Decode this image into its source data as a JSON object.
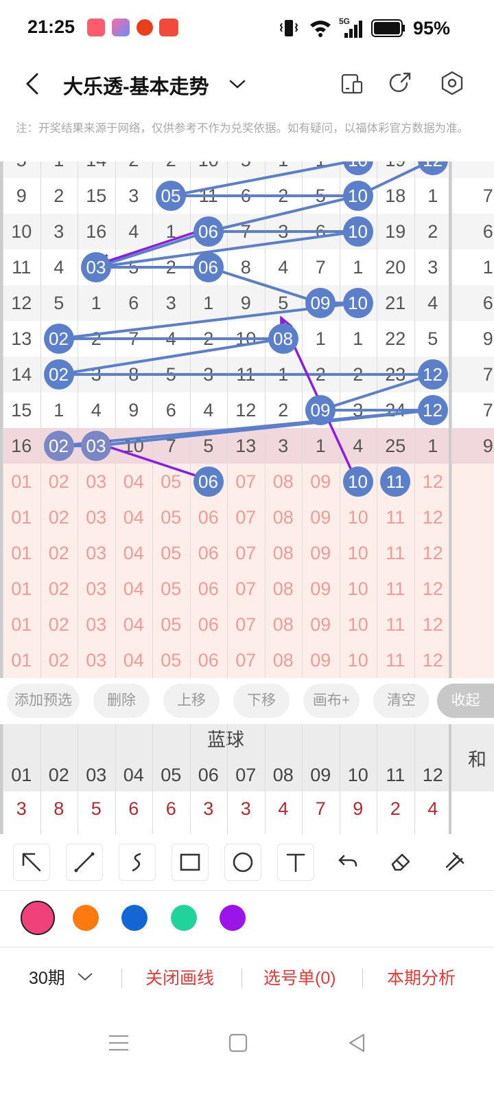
{
  "status": {
    "time": "21:25",
    "battery": "95%",
    "network": "5G"
  },
  "header": {
    "title": "大乐透-基本走势"
  },
  "note": "注：开奖结果来源于网络，仅供参考不作为兑奖依据。如有疑问，以福体彩官方数据为准。",
  "grid": {
    "partial_top": [
      "5",
      "1",
      "14",
      "2",
      "2",
      "10",
      "5",
      "1",
      "1",
      "10",
      "19",
      "12"
    ],
    "rows": [
      [
        "9",
        "2",
        "15",
        "3",
        "05",
        "11",
        "6",
        "2",
        "5",
        "10",
        "18",
        "1"
      ],
      [
        "10",
        "3",
        "16",
        "4",
        "1",
        "06",
        "7",
        "3",
        "6",
        "10",
        "19",
        "2"
      ],
      [
        "11",
        "4",
        "03",
        "5",
        "2",
        "06",
        "8",
        "4",
        "7",
        "1",
        "20",
        "3"
      ],
      [
        "12",
        "5",
        "1",
        "6",
        "3",
        "1",
        "9",
        "5",
        "09",
        "10",
        "21",
        "4"
      ],
      [
        "13",
        "02",
        "2",
        "7",
        "4",
        "2",
        "10",
        "08",
        "1",
        "1",
        "22",
        "5"
      ],
      [
        "14",
        "02",
        "3",
        "8",
        "5",
        "3",
        "11",
        "1",
        "2",
        "2",
        "23",
        "12"
      ],
      [
        "15",
        "1",
        "4",
        "9",
        "6",
        "4",
        "12",
        "2",
        "09",
        "3",
        "24",
        "12"
      ],
      [
        "16",
        "02",
        "03",
        "10",
        "7",
        "5",
        "13",
        "3",
        "1",
        "4",
        "25",
        "1"
      ]
    ],
    "side_partial": [
      "7",
      "6",
      "1",
      "6",
      "9",
      "7",
      "7",
      "9"
    ],
    "pick_rows": [
      [
        "01",
        "02",
        "03",
        "04",
        "05",
        "06",
        "07",
        "08",
        "09",
        "10",
        "11",
        "12"
      ],
      [
        "01",
        "02",
        "03",
        "04",
        "05",
        "06",
        "07",
        "08",
        "09",
        "10",
        "11",
        "12"
      ],
      [
        "01",
        "02",
        "03",
        "04",
        "05",
        "06",
        "07",
        "08",
        "09",
        "10",
        "11",
        "12"
      ],
      [
        "01",
        "02",
        "03",
        "04",
        "05",
        "06",
        "07",
        "08",
        "09",
        "10",
        "11",
        "12"
      ],
      [
        "01",
        "02",
        "03",
        "04",
        "05",
        "06",
        "07",
        "08",
        "09",
        "10",
        "11",
        "12"
      ],
      [
        "01",
        "02",
        "03",
        "04",
        "05",
        "06",
        "07",
        "08",
        "09",
        "10",
        "11",
        "12"
      ]
    ]
  },
  "actions": [
    "添加预选",
    "删除",
    "上移",
    "下移",
    "画布+",
    "清空",
    "收起"
  ],
  "blue_table": {
    "title": "蓝球",
    "side_label": "和",
    "numbers": [
      "01",
      "02",
      "03",
      "04",
      "05",
      "06",
      "07",
      "08",
      "09",
      "10",
      "11",
      "12"
    ],
    "counts": [
      "3",
      "8",
      "5",
      "6",
      "6",
      "3",
      "3",
      "4",
      "7",
      "9",
      "2",
      "4"
    ]
  },
  "tools": [
    "arrow-tool-icon",
    "line-tool-icon",
    "freehand-tool-icon",
    "rectangle-tool-icon",
    "circle-tool-icon",
    "text-tool-icon",
    "undo-icon",
    "eraser-icon",
    "clear-brush-icon"
  ],
  "colors": [
    "#f0417a",
    "#ff7a0e",
    "#1466d4",
    "#1fd39a",
    "#9b15e8"
  ],
  "bottom": {
    "period": "30期",
    "close_draw": "关闭画线",
    "pick_list": "选号单(0)",
    "analysis": "本期分析"
  }
}
